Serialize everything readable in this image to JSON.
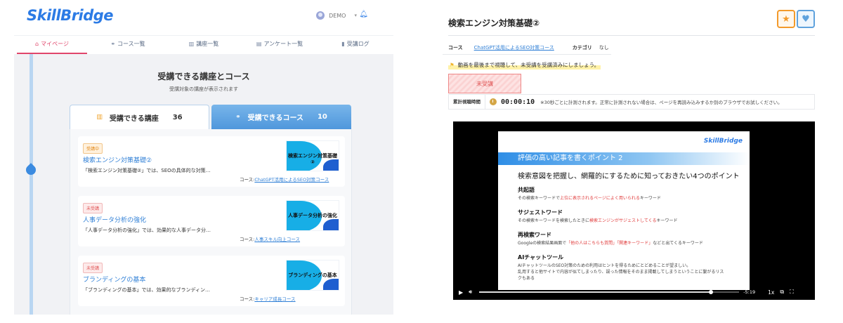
{
  "left": {
    "brand": "SkillBridge",
    "user": {
      "name": "DEMO"
    },
    "nav": [
      {
        "label": "マイページ",
        "icon": "home-icon",
        "active": true
      },
      {
        "label": "コース一覧",
        "icon": "course-icon"
      },
      {
        "label": "講座一覧",
        "icon": "book-icon"
      },
      {
        "label": "アンケート一覧",
        "icon": "survey-icon"
      },
      {
        "label": "受講ログ",
        "icon": "chart-icon"
      }
    ],
    "section_title": "受講できる講座とコース",
    "section_subtitle": "受講対象の講座が表示されます",
    "tabs": [
      {
        "label": "受講できる講座",
        "count": "36",
        "icon": "book-icon"
      },
      {
        "label": "受講できるコース",
        "count": "10",
        "icon": "course-icon"
      }
    ],
    "cards": [
      {
        "status": "受講中",
        "status_type": "active",
        "title": "検索エンジン対策基礎②",
        "description": "「検索エンジン対策基礎②」では、SEOの具体的な対策…",
        "course_label": "コース:",
        "course_link": "ChatGPT活用によるSEO対策コース",
        "thumb_title": "検索エンジン対策基礎②"
      },
      {
        "status": "未受講",
        "status_type": "pending",
        "title": "人事データ分析の強化",
        "description": "「人事データ分析の強化」では、効果的な人事データ分…",
        "course_label": "コース:",
        "course_link": "人事スキル向上コース",
        "thumb_title": "人事データ分析の強化"
      },
      {
        "status": "未受講",
        "status_type": "pending",
        "title": "ブランディングの基本",
        "description": "「ブランディングの基本」では、効果的なブランディン…",
        "course_label": "コース:",
        "course_link": "キャリア成長コース",
        "thumb_title": "ブランディングの基本"
      }
    ]
  },
  "right": {
    "title": "検索エンジン対策基礎②",
    "course_label": "コース",
    "course_link": "ChatGPT活用によるSEO対策コース",
    "category_label": "カテゴリ",
    "category_value": "なし",
    "notice": "動画を最後まで視聴して、未受講を受講済みにしましょう。",
    "status": "未受講",
    "timer_label": "累計視聴時間",
    "timer_value": "00:00:10",
    "timer_note": "※30秒ごとに計測されます。正常に計測されない場合は、ページを再読み込みするか別のブラウザでお試しください。",
    "video": {
      "slide_brand": "SkillBridge",
      "slide_heading": "評価の高い記事を書くポイント 2",
      "slide_subheading": "検索意図を把握し、網羅的にするために知っておきたい4つのポイント",
      "points": [
        {
          "title": "共起語",
          "desc_a": "その検索キーワードで",
          "desc_hl": "上位に表示されるページによく用いられる",
          "desc_b": "キーワード"
        },
        {
          "title": "サジェストワード",
          "desc_a": "その検索キーワードを検索したときに",
          "desc_hl": "検索エンジンがサジェストしてくる",
          "desc_b": "キーワード"
        },
        {
          "title": "再検索ワード",
          "desc_a": "Googleの検索結果画面で",
          "desc_hl": "「他の人はこちらも質問」「関連キーワード」",
          "desc_b": "などと出てくるキーワード"
        },
        {
          "title": "AIチャットツール",
          "desc_a": "AIチャットツールのSEO対策のための利用はヒントを得るためにとどめることが望ましい。",
          "desc_hl": "",
          "desc_b": ""
        }
      ],
      "point4_line2": "乱用すると他サイトで内容が似てしまったり、誤った情報をそのまま掲載してしまうということに繋がるリス",
      "point4_line3": "クもある",
      "time_remaining": "-5:19",
      "speed": "1x",
      "progress": 0.89
    }
  },
  "colors": {
    "brand": "#2c7be5",
    "active_nav": "#e0466b",
    "star": "#f39a2b",
    "heart": "#5fa2dd"
  }
}
